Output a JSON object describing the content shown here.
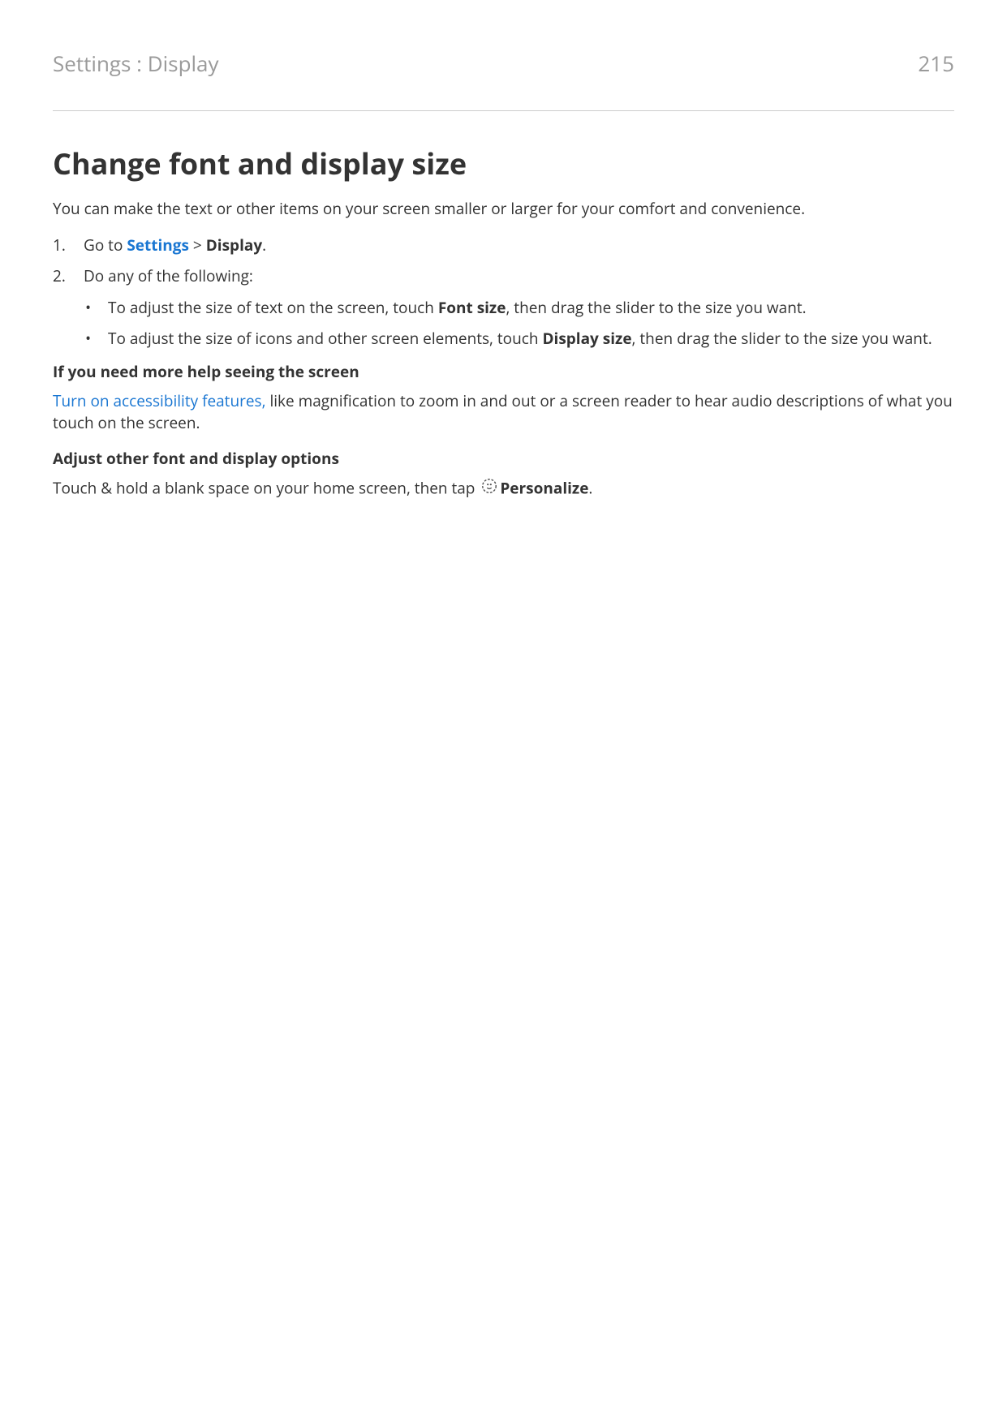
{
  "header": {
    "breadcrumb": "Settings : Display",
    "page_number": "215"
  },
  "title": "Change font and display size",
  "intro": "You can make the text or other items on your screen smaller or larger for your comfort and convenience.",
  "steps": {
    "s1_prefix": "Go to ",
    "s1_settings": "Settings",
    "s1_sep": " > ",
    "s1_display": "Display",
    "s1_suffix": ".",
    "s2_text": "Do any of the following:",
    "b1_prefix": "To adjust the size of text on the screen, touch ",
    "b1_bold": "Font size",
    "b1_suffix": ", then drag the slider to the size you want.",
    "b2_prefix": "To adjust the size of icons and other screen elements, touch ",
    "b2_bold": "Display size",
    "b2_suffix": ", then drag the slider to the size you want."
  },
  "section_help": {
    "heading": "If you need more help seeing the screen",
    "link": "Turn on accessibility features,",
    "rest": " like magnification to zoom in and out or a screen reader to hear audio descriptions of what you touch on the screen."
  },
  "section_adjust": {
    "heading": "Adjust other font and display options",
    "prefix": "Touch & hold a blank space on your home screen, then tap ",
    "bold": "Personalize",
    "suffix": "."
  }
}
